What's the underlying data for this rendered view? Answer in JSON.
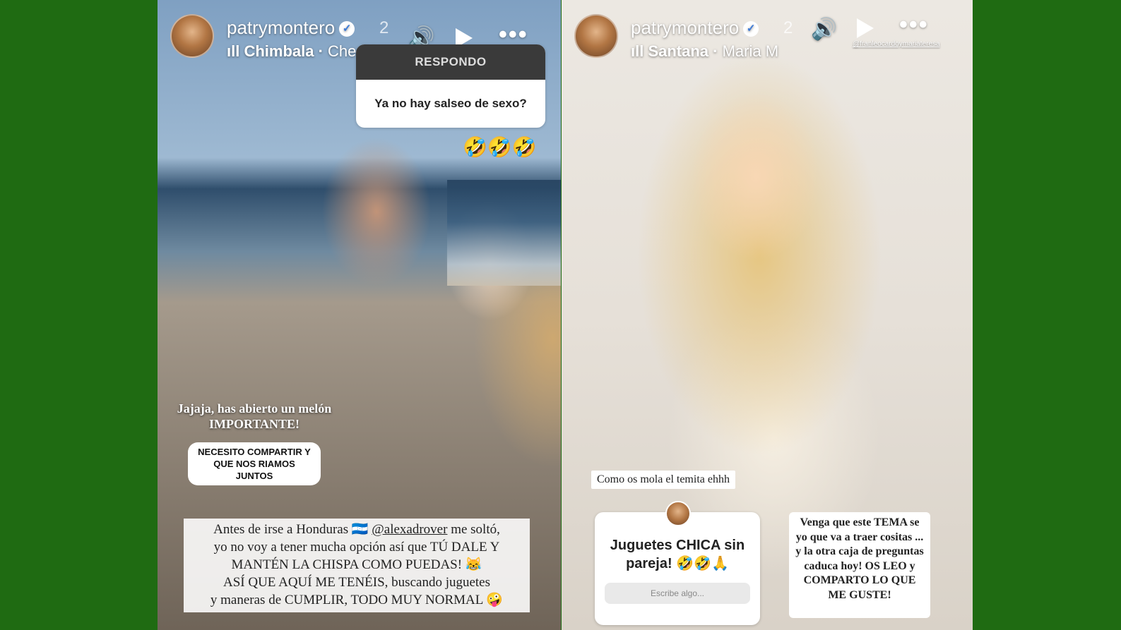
{
  "colors": {
    "background": "#1f6b12",
    "verified_badge": "#3b7ad8",
    "question_header": "#3a3a3a"
  },
  "left_story": {
    "username": "patrymontero",
    "time": "2",
    "song": "Chimbala",
    "artist": "Che Ch",
    "icons": {
      "volume": "volume-icon",
      "play": "play-icon",
      "more": "more-icon"
    },
    "question_card": {
      "header": "RESPONDO",
      "question": "Ya no hay salseo de sexo?"
    },
    "emojis": "🤣🤣🤣",
    "caption": "Jajaja, has abierto un melón IMPORTANTE!",
    "pill": "NECESITO COMPARTIR Y QUE NOS RIAMOS JUNTOS",
    "text_block": {
      "line1_prefix": "Antes de irse a Honduras 🇭🇳",
      "mention": "@alexadrover",
      "line1_suffix": " me soltó,",
      "line2": "yo no voy a tener mucha opción así que TÚ DALE Y",
      "line3": "MANTÉN LA CHISPA COMO PUEDAS! 😹",
      "line4": "ASÍ QUE AQUÍ ME TENÉIS, buscando juguetes",
      "line5": "y maneras de CUMPLIR, TODO MUY NORMAL 🤪"
    }
  },
  "right_story": {
    "username": "patrymontero",
    "time": "2",
    "song": "Santana",
    "artist": "Maria M",
    "credit_tag": "@franleocardoymariateresa",
    "icons": {
      "volume": "volume-icon",
      "play": "play-icon",
      "more": "more-icon"
    },
    "label": "Como os mola el temita ehhh",
    "question_box": {
      "text": "Juguetes CHICA sin pareja! 🤣🤣🙏",
      "placeholder": "Escribe algo..."
    },
    "caption": "Venga que este TEMA se yo que va a traer cositas ... y la otra caja de preguntas caduca hoy! OS LEO y COMPARTO LO QUE ME GUSTE!"
  }
}
